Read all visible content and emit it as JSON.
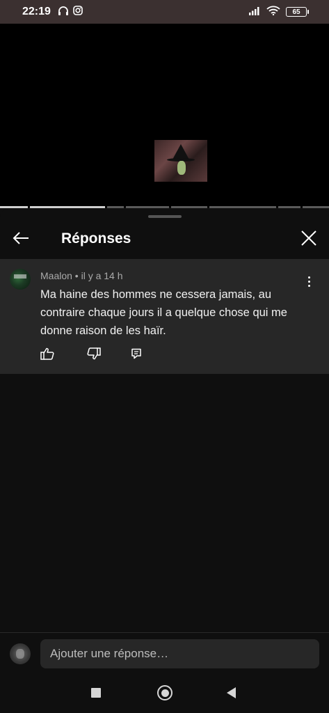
{
  "status_bar": {
    "time": "22:19",
    "battery_level": "65",
    "icons": [
      "headphones-icon",
      "instagram-icon",
      "signal-icon",
      "wifi-icon",
      "battery-icon"
    ]
  },
  "video": {
    "progress_segments_played": 2,
    "progress_segments_total": 8
  },
  "sheet": {
    "title": "Réponses",
    "back_icon": "arrow-left-icon",
    "close_icon": "close-icon"
  },
  "comment": {
    "author": "Maalon",
    "time": "il y a 14 h",
    "meta": "Maalon • il y a 14 h",
    "text": "Ma haine des hommes ne cessera jamais, au contraire chaque jours il a quelque chose qui me donne raison de les haïr.",
    "actions": [
      "thumbs-up-icon",
      "thumbs-down-icon",
      "reply-icon"
    ]
  },
  "reply_bar": {
    "placeholder": "Ajouter une réponse…"
  },
  "nav_bar": {
    "buttons": [
      "recent-apps-button",
      "home-button",
      "back-button"
    ]
  },
  "colors": {
    "status_bar_bg": "#3b3030",
    "background": "#0f0f0f",
    "comment_bg": "#272727",
    "secondary_text": "#aaaaaa"
  }
}
